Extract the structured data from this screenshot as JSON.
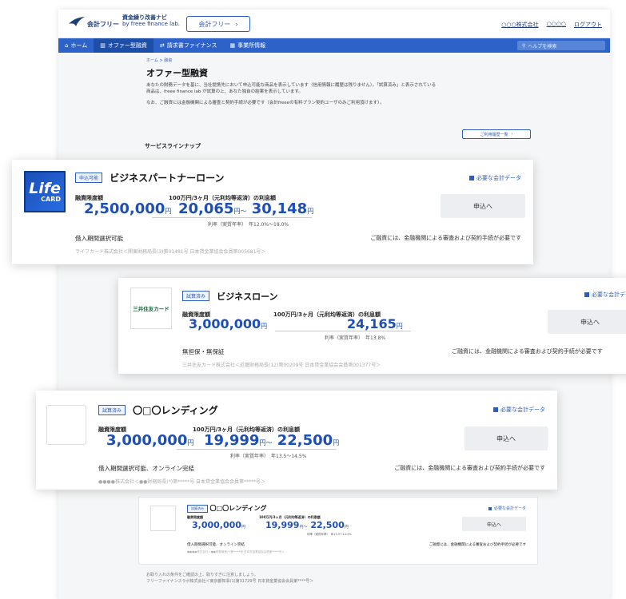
{
  "header": {
    "logo_top": "資金繰り改善ナビ",
    "logo_main": "会計フリー",
    "logo_sub": "by freee finance lab.",
    "tag_button": "会計フリー",
    "company": "○○○株式会社",
    "user": "○○○○",
    "logout": "ログアウト"
  },
  "nav": {
    "items": [
      {
        "label": "ホーム",
        "icon": "home-icon"
      },
      {
        "label": "オファー型融資",
        "icon": "bank-icon"
      },
      {
        "label": "請求書ファイナンス",
        "icon": "exchange-icon"
      },
      {
        "label": "事業所情報",
        "icon": "building-icon"
      }
    ],
    "search_placeholder": "ヘルプを検索"
  },
  "main": {
    "breadcrumb": "ホーム > 融資",
    "title": "オファー型融資",
    "desc1": "あなたの財務データを基に、当社提携先において申込可能な商品を表示しています（信用情報に履歴は残りません）。「試算済み」と表示されている",
    "desc2": "商品は、freee finance lab が試算の上、あなた独自の結果を表示しています。",
    "note": "なお、ご融資には金融機関による審査と契約手続が必要です（会計freeeの有料プラン契約ユーザのみご利用頂けます）。",
    "list_button": "ご利用履歴一覧",
    "service_lineup": "サービスラインナップ"
  },
  "cards": [
    {
      "logo_line1": "Life",
      "logo_line2": "CARD",
      "status": "申込可能",
      "title": "ビジネスパートナーローン",
      "need_label": "必要な会計データ",
      "limit_label": "融資限度額",
      "limit_value": "2,500,000",
      "yen": "円",
      "interest_label": "100万円/3ヶ月（元利均等返済）の利息額",
      "interest_min": "20,065",
      "interest_sep": "円～",
      "interest_max": "30,148",
      "rate": "利率（実質年率）　年12.0%～18.0%",
      "apply": "申込へ",
      "cond": "借入期間選択可能",
      "notice": "ご融資には、金融機関による審査および契約手続が必要です",
      "footer": "ライフカード株式会社＜関東財務局長(3)第01481号 日本貸金業協会会員第005681号＞"
    },
    {
      "logo_text": "三井住友カード",
      "status": "試算済み",
      "title": "ビジネスローン",
      "need_label": "必要な会計データ",
      "limit_label": "融資限度額",
      "limit_value": "3,000,000",
      "yen": "円",
      "interest_label": "100万円/3ヶ月（元利均等返済）の利息額",
      "interest_value": "24,165",
      "rate": "利率（実質年率）　年13.8%",
      "apply": "申込へ",
      "cond": "無担保・無保証",
      "notice": "ご融資には、金融機関による審査および契約手続が必要です",
      "footer": "三井住友カード株式会社＜近畿財務局長(12)第00209号 日本貸金業協会会員第001377号＞"
    },
    {
      "status": "試算済み",
      "title": "〇□〇レンディング",
      "need_label": "必要な会計データ",
      "limit_label": "融資限度額",
      "limit_value": "3,000,000",
      "yen": "円",
      "interest_label": "100万円/3ヶ月（元利均等返済）の利息額",
      "interest_min": "19,999",
      "interest_sep": "円～",
      "interest_max": "22,500",
      "rate": "利率（実質年率）　年13.5～14.5%",
      "apply": "申込へ",
      "cond": "借入期間選択可能、オンライン完結",
      "notice": "ご融資には、金融機関による審査および契約手続が必要です",
      "footer": "●●●●株式会社＜●●財務局長(*)第*****号 日本貸金業協会会員第*****号＞"
    },
    {
      "status": "試算済み",
      "title": "〇□〇レンディング",
      "need_label": "必要な会計データ",
      "limit_label": "融資限度額",
      "limit_value": "3,000,000",
      "yen": "円",
      "interest_label": "100万円/3ヶ月（元利均等返済）の利息額",
      "interest_min": "19,999",
      "interest_sep": "円～",
      "interest_max": "22,500",
      "rate": "利率（実質年率）　年13.5～14.5%",
      "apply": "申込へ",
      "cond": "借入期間選択可能、オンライン完結",
      "notice": "ご融資には、金融機関による審査および契約手続が必要です",
      "footer": "●●●●株式会社＜●●財務局長(*)第*****号 日本貸金業協会会員第*****号＞"
    }
  ],
  "bottom": {
    "line1": "お取り入れの条件をご確認の上、取りすぎに注意しましょう。",
    "line2": "フリーファイナンスラボ株式会社＜東京都知事(1)第31729号 日本貸金業協会会員第****号＞"
  },
  "colors": {
    "accent": "#2d63c8",
    "amount": "#1d4fb4"
  }
}
